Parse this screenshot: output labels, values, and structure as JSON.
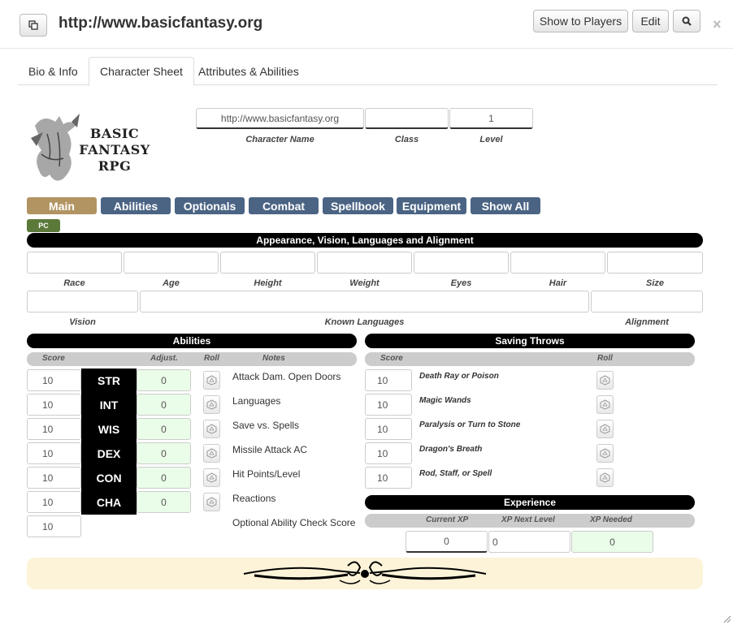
{
  "header": {
    "title": "http://www.basicfantasy.org",
    "show_to_players": "Show to Players",
    "edit": "Edit",
    "close": "×"
  },
  "tabs": [
    "Bio & Info",
    "Character Sheet",
    "Attributes & Abilities"
  ],
  "logo": {
    "line1": "BASIC",
    "line2": "FANTASY",
    "line3": "RPG"
  },
  "character": {
    "name_value": "http://www.basicfantasy.org",
    "name_label": "Character Name",
    "class_value": "",
    "class_label": "Class",
    "level_value": "1",
    "level_label": "Level"
  },
  "nav": [
    "Main",
    "Abilities",
    "Optionals",
    "Combat",
    "Spellbook",
    "Equipment",
    "Show All"
  ],
  "pc_badge": "PC",
  "appearance": {
    "title": "Appearance, Vision, Languages and Alignment",
    "row1_labels": [
      "Race",
      "Age",
      "Height",
      "Weight",
      "Eyes",
      "Hair",
      "Size"
    ],
    "row2_labels": [
      "Vision",
      "Known Languages",
      "Alignment"
    ]
  },
  "abilities": {
    "title": "Abilities",
    "headers": {
      "score": "Score",
      "adjust": "Adjust.",
      "roll": "Roll",
      "notes": "Notes"
    },
    "rows": [
      {
        "score": "10",
        "name": "STR",
        "adj": "0",
        "note": "Attack Dam. Open Doors"
      },
      {
        "score": "10",
        "name": "INT",
        "adj": "0",
        "note": "Languages"
      },
      {
        "score": "10",
        "name": "WIS",
        "adj": "0",
        "note": "Save vs. Spells"
      },
      {
        "score": "10",
        "name": "DEX",
        "adj": "0",
        "note": "Missile Attack AC"
      },
      {
        "score": "10",
        "name": "CON",
        "adj": "0",
        "note": "Hit Points/Level"
      },
      {
        "score": "10",
        "name": "CHA",
        "adj": "0",
        "note": "Reactions"
      }
    ],
    "optional_score": "10",
    "optional_label": "Optional Ability Check Score"
  },
  "saving_throws": {
    "title": "Saving Throws",
    "headers": {
      "score": "Score",
      "roll": "Roll"
    },
    "rows": [
      {
        "score": "10",
        "name": "Death Ray or Poison"
      },
      {
        "score": "10",
        "name": "Magic Wands"
      },
      {
        "score": "10",
        "name": "Paralysis or Turn to Stone"
      },
      {
        "score": "10",
        "name": "Dragon's Breath"
      },
      {
        "score": "10",
        "name": "Rod, Staff, or Spell"
      }
    ]
  },
  "experience": {
    "title": "Experience",
    "headers": {
      "current": "Current XP",
      "next": "XP Next Level",
      "needed": "XP Needed"
    },
    "current": "0",
    "next": "0",
    "needed": "0"
  }
}
